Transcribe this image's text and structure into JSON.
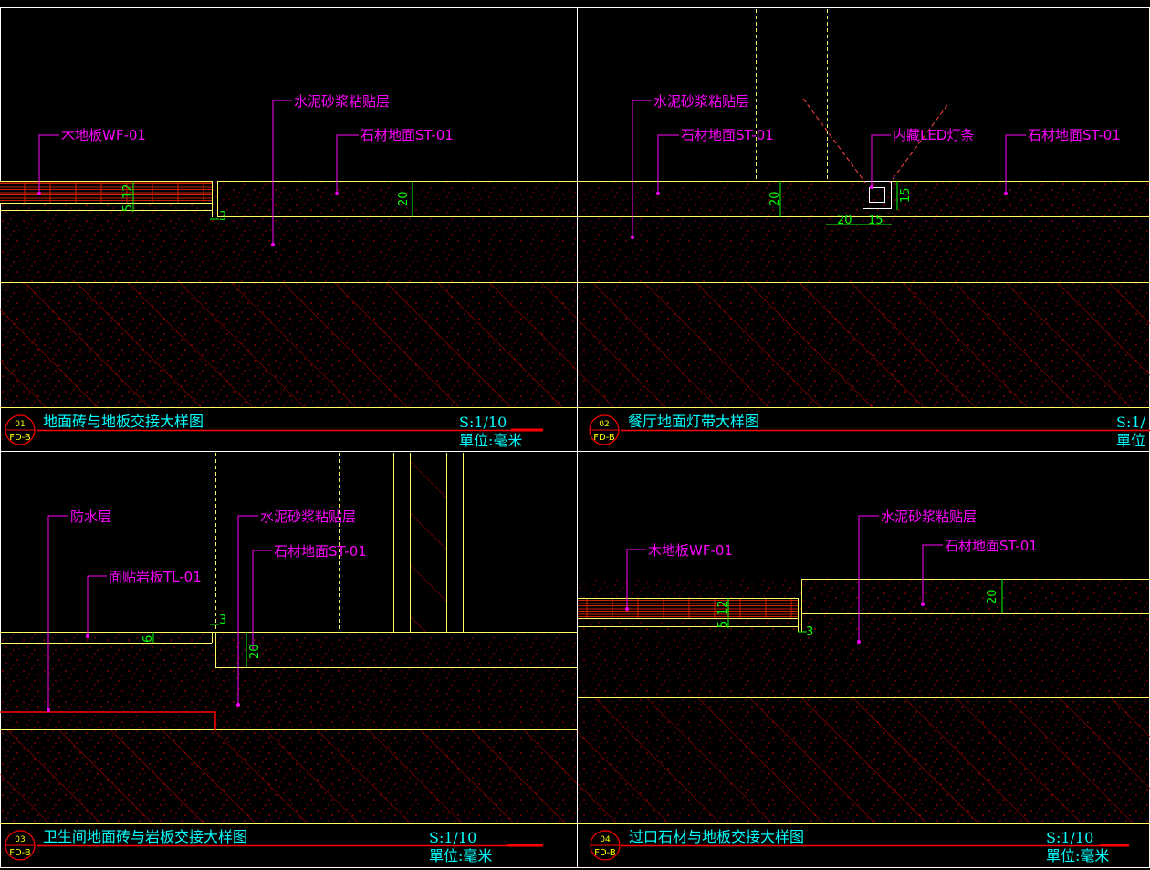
{
  "colors": {
    "background": "#000000",
    "line": "#ffff66",
    "hatch": "#cc0000",
    "label": "#ff00ff",
    "dimension": "#00ff00",
    "title": "#00ffff",
    "accent": "#ff0000"
  },
  "panels": [
    {
      "number": "01",
      "ref": "FD-B",
      "title": "地面砖与地板交接大样图",
      "scale": "S:1/10",
      "unit": "單位:毫米",
      "labels": [
        "木地板WF-01",
        "水泥砂浆粘贴层",
        "石材地面ST-01"
      ],
      "dims": [
        "5",
        "12",
        "3",
        "20"
      ]
    },
    {
      "number": "02",
      "ref": "FD-B",
      "title": "餐厅地面灯带大样图",
      "scale": "S:1/",
      "unit": "單位",
      "labels": [
        "水泥砂浆粘贴层",
        "石材地面ST-01",
        "内藏LED灯条",
        "石材地面ST-01"
      ],
      "dims": [
        "20",
        "20",
        "15",
        "15"
      ]
    },
    {
      "number": "03",
      "ref": "FD-B",
      "title": "卫生间地面砖与岩板交接大样图",
      "scale": "S:1/10",
      "unit": "單位:毫米",
      "labels": [
        "防水层",
        "面贴岩板TL-01",
        "水泥砂浆粘贴层",
        "石材地面ST-01"
      ],
      "dims": [
        "6",
        "3",
        "20"
      ]
    },
    {
      "number": "04",
      "ref": "FD-B",
      "title": "过口石材与地板交接大样图",
      "scale": "S:1/10",
      "unit": "單位:毫米",
      "labels": [
        "木地板WF-01",
        "水泥砂浆粘贴层",
        "石材地面ST-01"
      ],
      "dims": [
        "5",
        "12",
        "3",
        "20"
      ]
    }
  ]
}
